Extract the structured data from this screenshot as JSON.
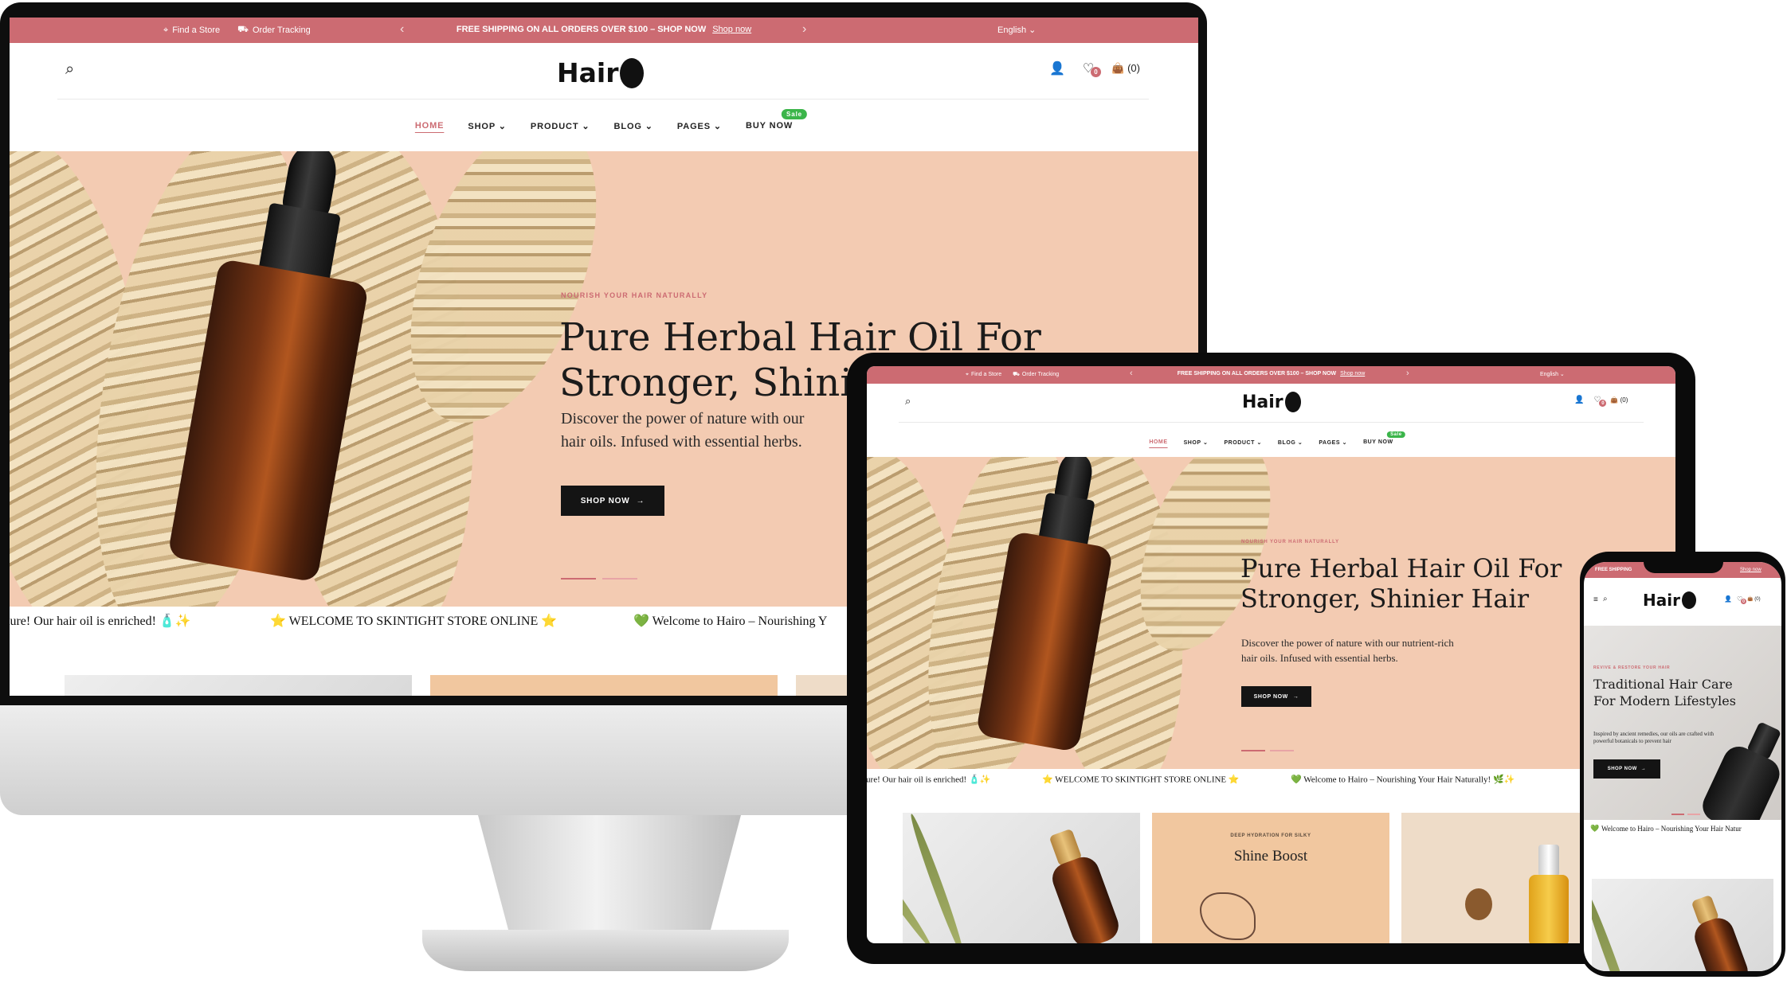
{
  "topbar": {
    "find_store": "Find a Store",
    "order_tracking": "Order Tracking",
    "promo": "FREE SHIPPING ON ALL ORDERS OVER $100 – SHOP NOW",
    "shop_now_link": "Shop now",
    "language": "English",
    "phone_promo": "FREE SHIPPING",
    "phone_shop_now": "Shop now"
  },
  "header": {
    "logo_text": "Hair",
    "wishlist_count": "0",
    "cart_count": "(0)"
  },
  "nav": {
    "items": [
      {
        "label": "HOME"
      },
      {
        "label": "SHOP"
      },
      {
        "label": "PRODUCT"
      },
      {
        "label": "BLOG"
      },
      {
        "label": "PAGES"
      },
      {
        "label": "BUY NOW"
      }
    ],
    "sale_badge": "Sale",
    "active_color": "#cc6b72"
  },
  "hero": {
    "eyebrow": "NOURISH YOUR HAIR NATURALLY",
    "title_line1": "Pure Herbal Hair Oil For",
    "title_line2": "Stronger, Shinier Hair",
    "title_line2_desktop": "Stronger, Shinie",
    "desc_line1": "Discover the power of nature with our nutrient-rich",
    "desc_line2": "hair oils. Infused with essential herbs.",
    "desc_line1_desktop": "Discover the power of nature with our",
    "button": "SHOP NOW",
    "bg_color": "#f3cbb2"
  },
  "ticker": {
    "item1": "ture! Our hair oil is enriched! 🧴✨",
    "item2": "⭐ WELCOME TO SKINTIGHT STORE ONLINE ⭐",
    "item3": "💚 Welcome to Hairo – Nourishing Your Hair Naturally! 🌿✨",
    "item3_desktop": "💚 Welcome to Hairo – Nourishing Y",
    "item_phone": "Welcome to Hairo – Nourishing Your Hair Natur"
  },
  "cards": {
    "b_eyebrow": "DEEP HYDRATION FOR SILKY",
    "b_title": "Shine Boost"
  },
  "phone_hero": {
    "eyebrow": "REVIVE & RESTORE YOUR HAIR",
    "title_line1": "Traditional Hair Care",
    "title_line2": "For Modern Lifestyles",
    "desc_line1": "Inspired by ancient remedies, our oils are crafted with",
    "desc_line2": "powerful botanicals to prevent hair",
    "button": "SHOP NOW"
  },
  "colors": {
    "brand": "#cc6b72",
    "sale_green": "#3bb54a",
    "button_dark": "#141414"
  }
}
